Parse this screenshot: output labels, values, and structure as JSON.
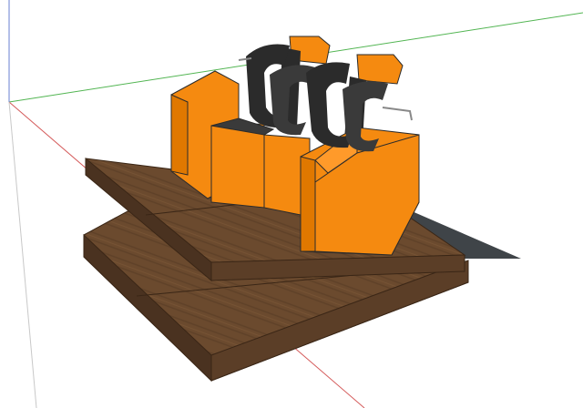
{
  "viewport": {
    "background": "#ffffff",
    "axis_colors": {
      "green": "#52b552",
      "red": "#d45a5a",
      "blue": "#6a7fd0",
      "gray": "#bfbfbf"
    }
  },
  "model": {
    "seat_color": "#f58a10",
    "seat_shadow": "#c86600",
    "harness_color": "#2b2b2b",
    "wood_color": "#6b4a2e",
    "wood_dark": "#4a3220",
    "shadow_color": "#3f4448"
  }
}
